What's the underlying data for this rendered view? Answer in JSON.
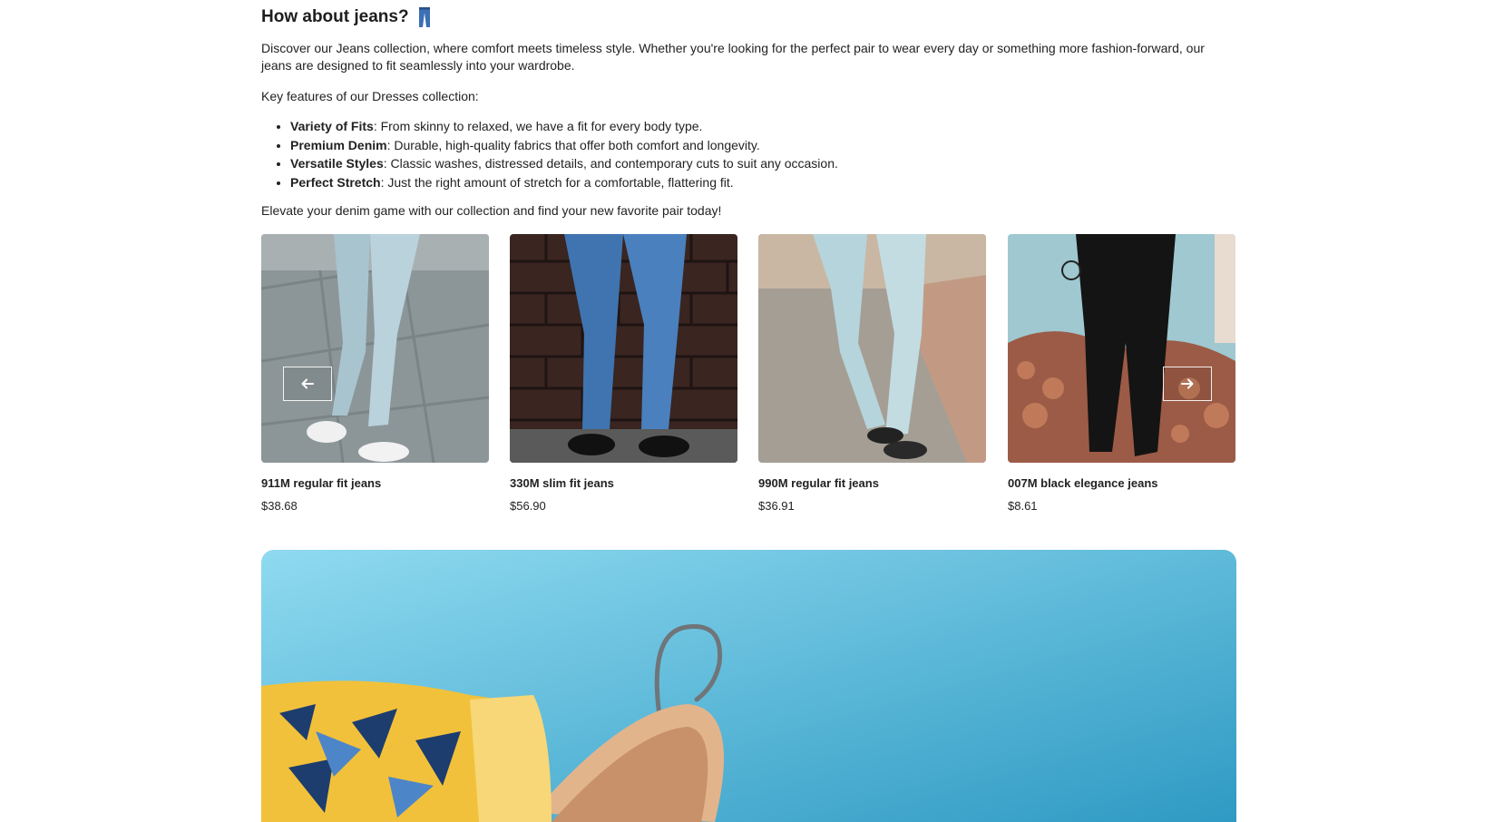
{
  "section": {
    "title": "How about jeans?",
    "title_icon": "jeans-icon",
    "intro": "Discover our Jeans collection, where comfort meets timeless style. Whether you're looking for the perfect pair to wear every day or something more fashion-forward, our jeans are designed to fit seamlessly into your wardrobe.",
    "key_features_heading": "Key features of our Dresses collection:",
    "features": [
      {
        "label": "Variety of Fits",
        "text": ": From skinny to relaxed, we have a fit for every body type."
      },
      {
        "label": "Premium Denim",
        "text": ": Durable, high-quality fabrics that offer both comfort and longevity."
      },
      {
        "label": "Versatile Styles",
        "text": ": Classic washes, distressed details, and contemporary cuts to suit any occasion."
      },
      {
        "label": "Perfect Stretch",
        "text": ": Just the right amount of stretch for a comfortable, flattering fit."
      }
    ],
    "outro": "Elevate your denim game with our collection and find your new favorite pair today!"
  },
  "carousel": {
    "prev_icon": "arrow-left-icon",
    "next_icon": "arrow-right-icon",
    "products": [
      {
        "name": "911M regular fit jeans",
        "price": "$38.68"
      },
      {
        "name": "330M slim fit jeans",
        "price": "$56.90"
      },
      {
        "name": "990M regular fit jeans",
        "price": "$36.91"
      },
      {
        "name": "007M black elegance jeans",
        "price": "$8.61"
      }
    ]
  },
  "colors": {
    "banner_bg": "#5cc0e0",
    "text": "#222222"
  }
}
